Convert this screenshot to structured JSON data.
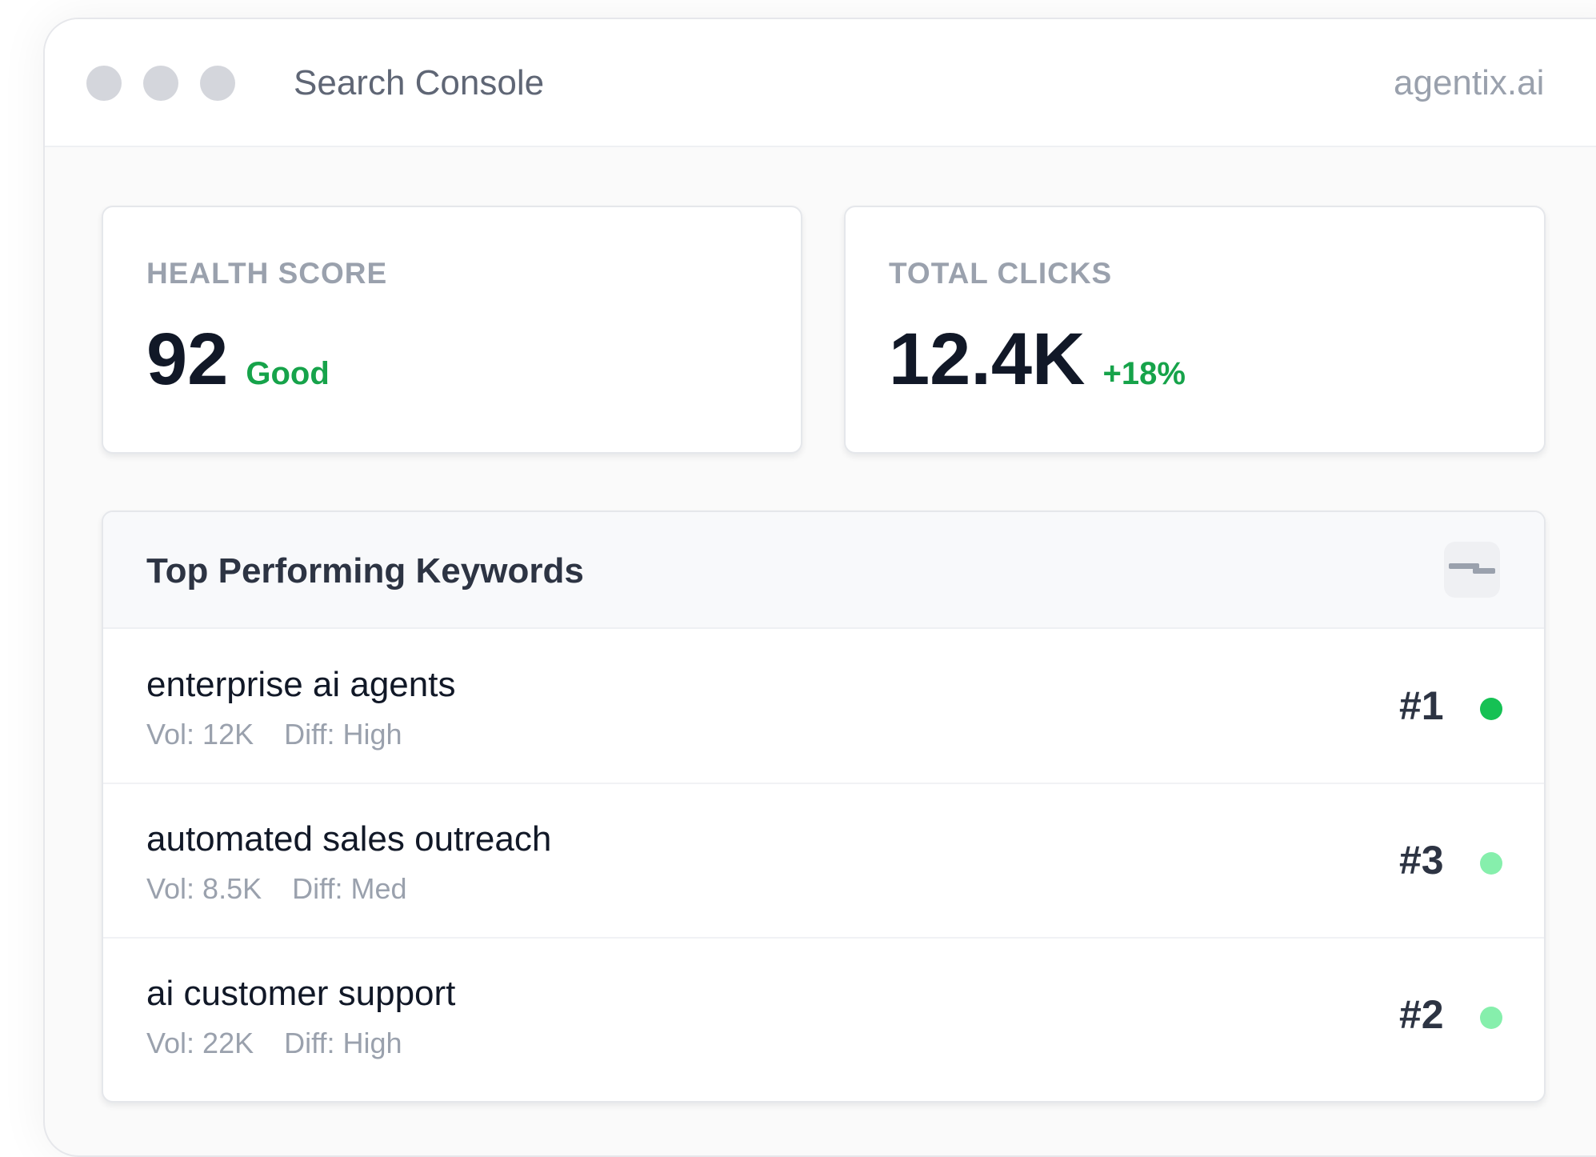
{
  "window": {
    "title": "Search Console",
    "domain": "agentix.ai"
  },
  "stats": [
    {
      "label": "HEALTH SCORE",
      "value": "92",
      "badge": "Good"
    },
    {
      "label": "TOTAL CLICKS",
      "value": "12.4K",
      "badge": "+18%"
    }
  ],
  "keywords": {
    "title": "Top Performing Keywords",
    "menu_icon": "toggle-icon",
    "rows": [
      {
        "name": "enterprise ai agents",
        "vol": "Vol: 12K",
        "diff": "Diff: High",
        "rank": "#1",
        "status_color": "#16c154"
      },
      {
        "name": "automated sales outreach",
        "vol": "Vol: 8.5K",
        "diff": "Diff: Med",
        "rank": "#3",
        "status_color": "#86efac"
      },
      {
        "name": "ai customer support",
        "vol": "Vol: 22K",
        "diff": "Diff: High",
        "rank": "#2",
        "status_color": "#86efac"
      }
    ]
  },
  "colors": {
    "accent_green": "#16a34a",
    "text_dark": "#111827",
    "text_muted": "#9aa1ad"
  }
}
